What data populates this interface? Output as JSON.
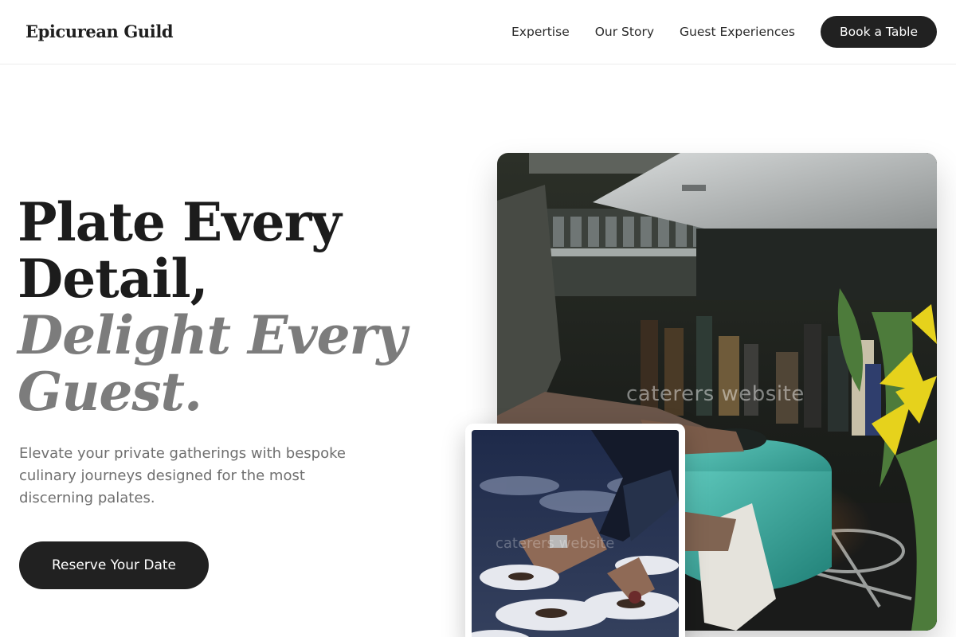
{
  "header": {
    "brand": "Epicurean Guild",
    "nav": [
      "Expertise",
      "Our Story",
      "Guest Experiences"
    ],
    "cta": "Book a Table"
  },
  "hero": {
    "title_line1": "Plate Every",
    "title_line2": "Detail,",
    "accent_line1": "Delight Every",
    "accent_line2": "Guest.",
    "subtitle": "Elevate your private gatherings with bespoke culinary journeys designed for the most discerning palates.",
    "button": "Reserve Your Date"
  },
  "images": {
    "main_watermark": "caterers website",
    "sub_watermark": "caterers website"
  },
  "colors": {
    "dark": "#212121",
    "muted": "#7c7c7c",
    "pot": "#2fa69a",
    "lily": "#e6d21c"
  }
}
